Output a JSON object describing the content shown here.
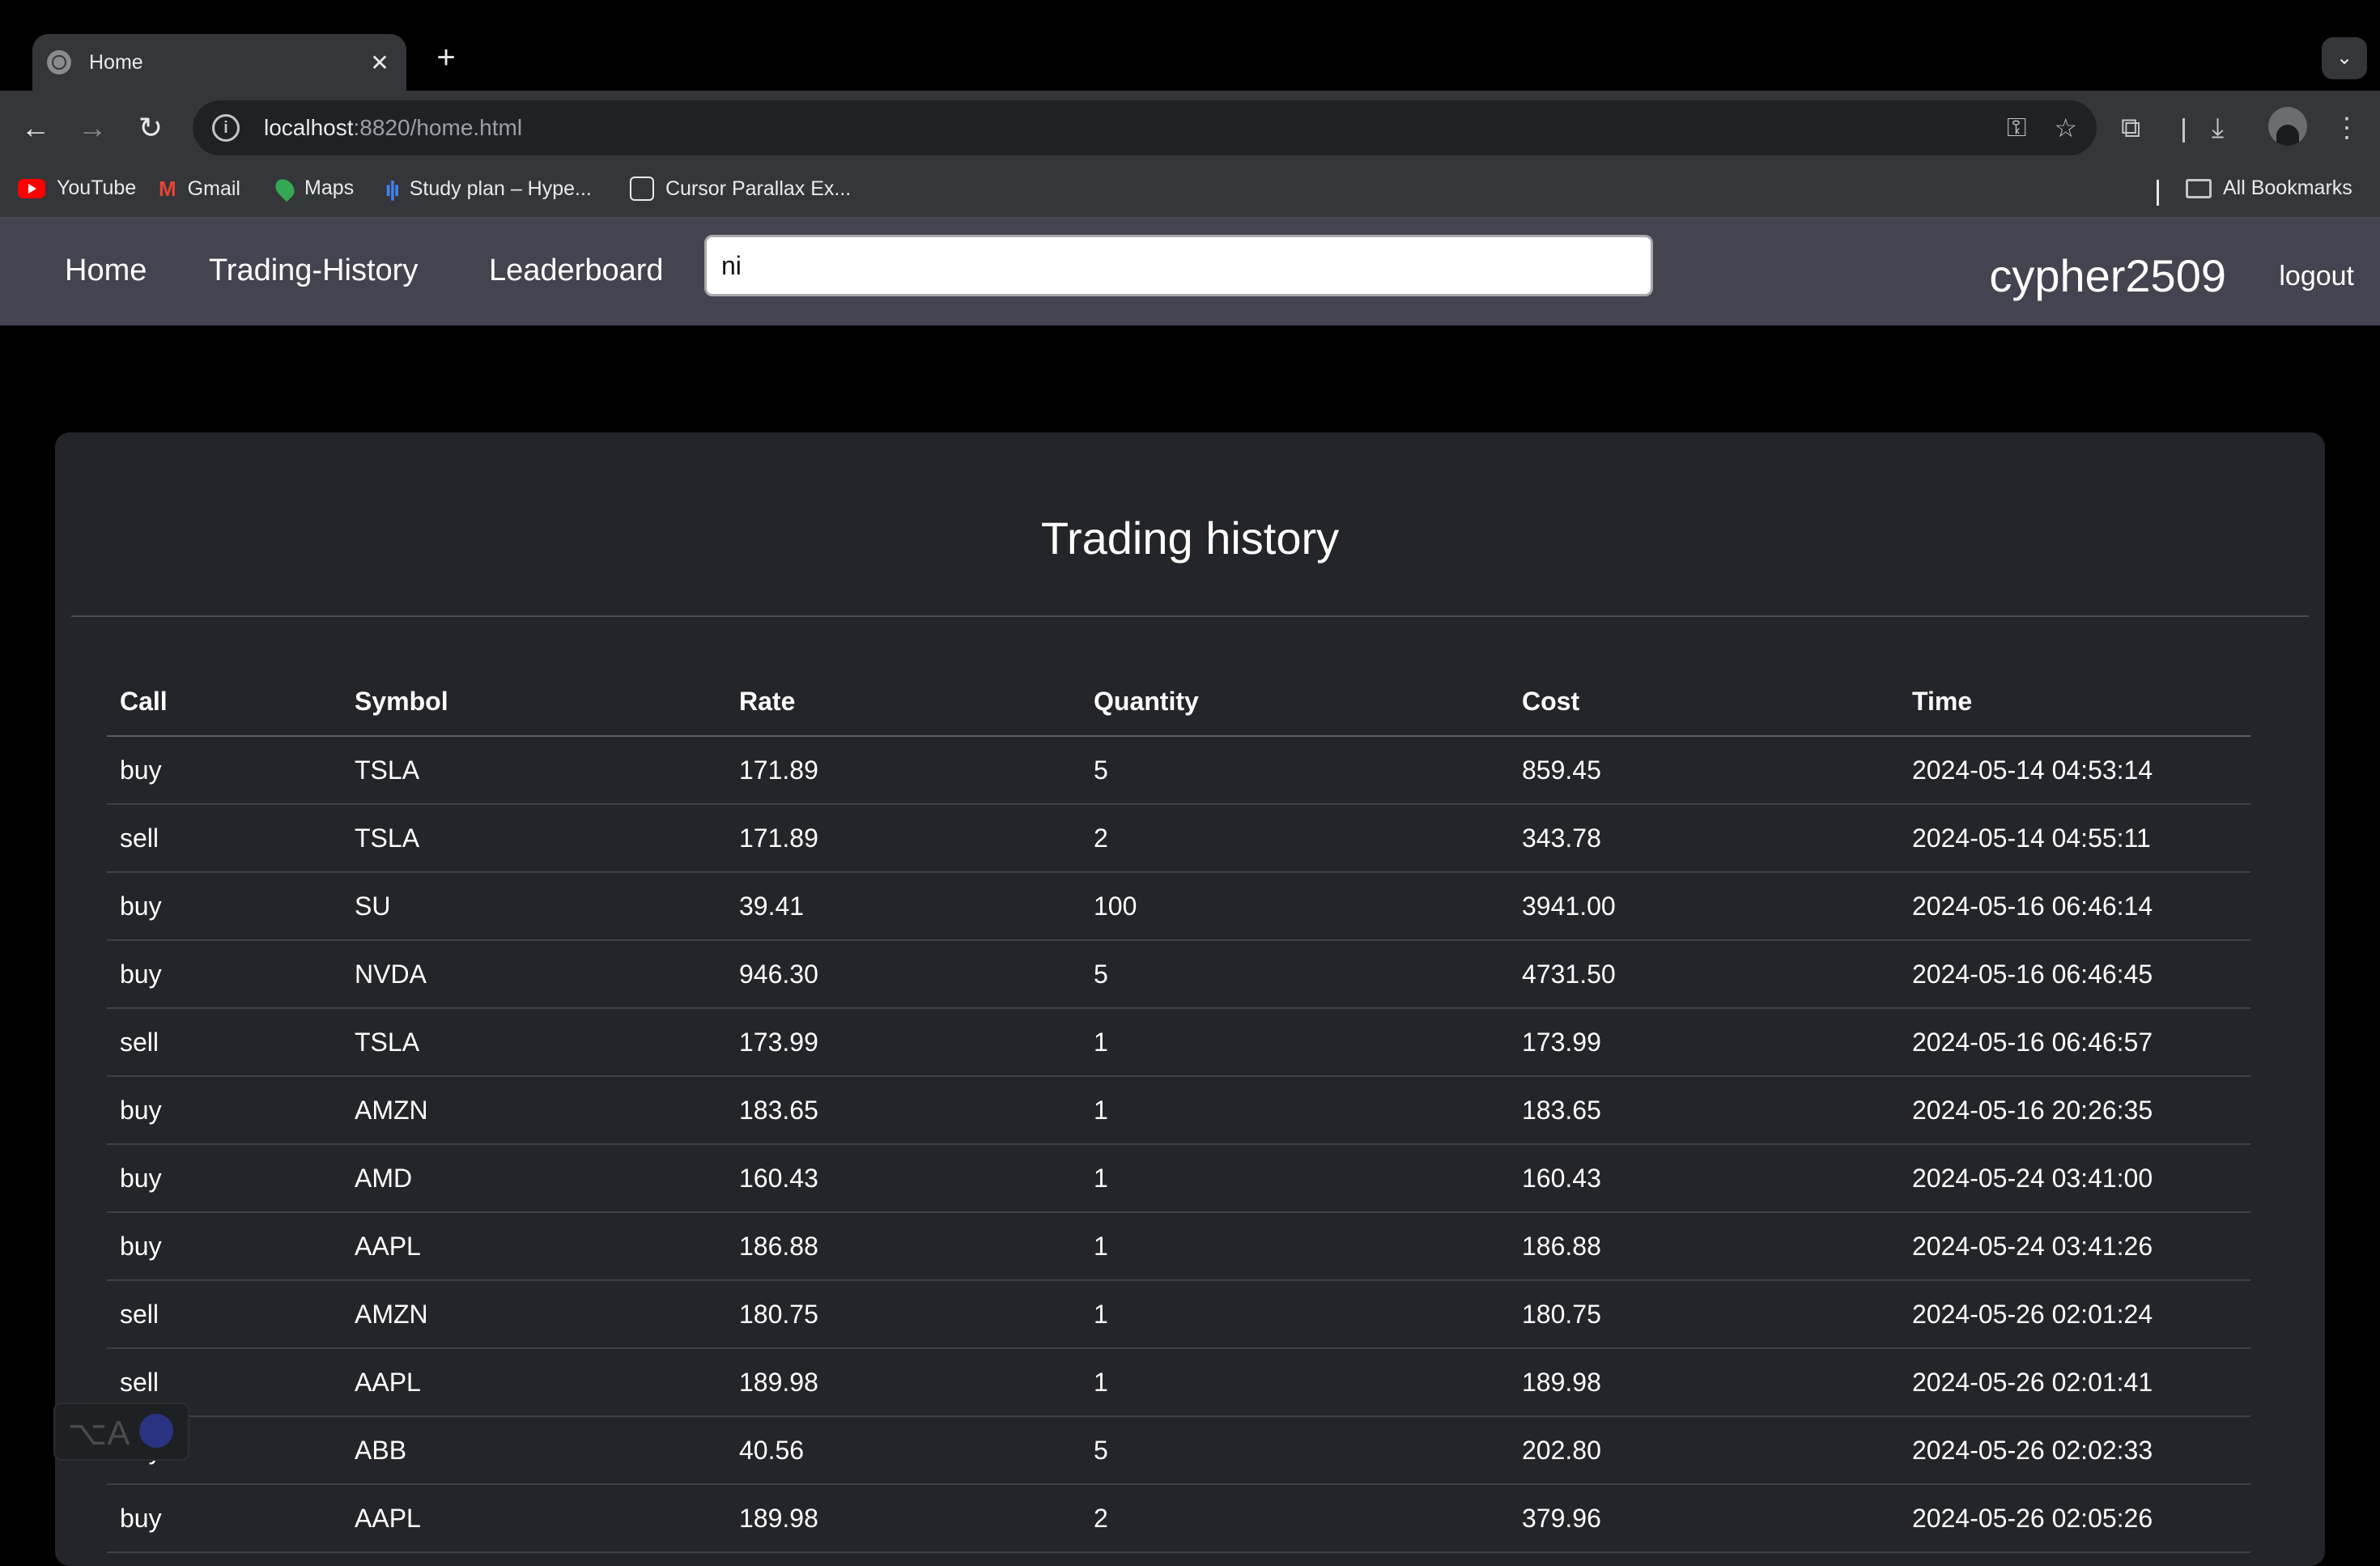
{
  "browser": {
    "tab_title": "Home",
    "tab_close": "✕",
    "new_tab": "+",
    "url_host": "localhost",
    "url_rest": ":8820/home.html",
    "bookmarks": [
      {
        "label": "YouTube",
        "icon": "youtube-icon"
      },
      {
        "label": "Gmail",
        "icon": "gmail-icon"
      },
      {
        "label": "Maps",
        "icon": "maps-icon"
      },
      {
        "label": "Study plan – Hype...",
        "icon": "study-plan-icon"
      },
      {
        "label": "Cursor Parallax Ex...",
        "icon": "codepen-icon"
      }
    ],
    "all_bookmarks": "All Bookmarks"
  },
  "nav": {
    "home": "Home",
    "trading_history": "Trading-History",
    "leaderboard": "Leaderboard",
    "search_value": "ni",
    "username": "cypher2509",
    "logout": "logout"
  },
  "history": {
    "title": "Trading history",
    "columns": [
      "Call",
      "Symbol",
      "Rate",
      "Quantity",
      "Cost",
      "Time"
    ],
    "rows": [
      [
        "buy",
        "TSLA",
        "171.89",
        "5",
        "859.45",
        "2024-05-14 04:53:14"
      ],
      [
        "sell",
        "TSLA",
        "171.89",
        "2",
        "343.78",
        "2024-05-14 04:55:11"
      ],
      [
        "buy",
        "SU",
        "39.41",
        "100",
        "3941.00",
        "2024-05-16 06:46:14"
      ],
      [
        "buy",
        "NVDA",
        "946.30",
        "5",
        "4731.50",
        "2024-05-16 06:46:45"
      ],
      [
        "sell",
        "TSLA",
        "173.99",
        "1",
        "173.99",
        "2024-05-16 06:46:57"
      ],
      [
        "buy",
        "AMZN",
        "183.65",
        "1",
        "183.65",
        "2024-05-16 20:26:35"
      ],
      [
        "buy",
        "AMD",
        "160.43",
        "1",
        "160.43",
        "2024-05-24 03:41:00"
      ],
      [
        "buy",
        "AAPL",
        "186.88",
        "1",
        "186.88",
        "2024-05-24 03:41:26"
      ],
      [
        "sell",
        "AMZN",
        "180.75",
        "1",
        "180.75",
        "2024-05-26 02:01:24"
      ],
      [
        "sell",
        "AAPL",
        "189.98",
        "1",
        "189.98",
        "2024-05-26 02:01:41"
      ],
      [
        "buy",
        "ABB",
        "40.56",
        "5",
        "202.80",
        "2024-05-26 02:02:33"
      ],
      [
        "buy",
        "AAPL",
        "189.98",
        "2",
        "379.96",
        "2024-05-26 02:05:26"
      ]
    ]
  },
  "colors": {
    "navbar_bg": "#43444f",
    "card_bg": "#23252a",
    "page_bg": "#000000"
  }
}
